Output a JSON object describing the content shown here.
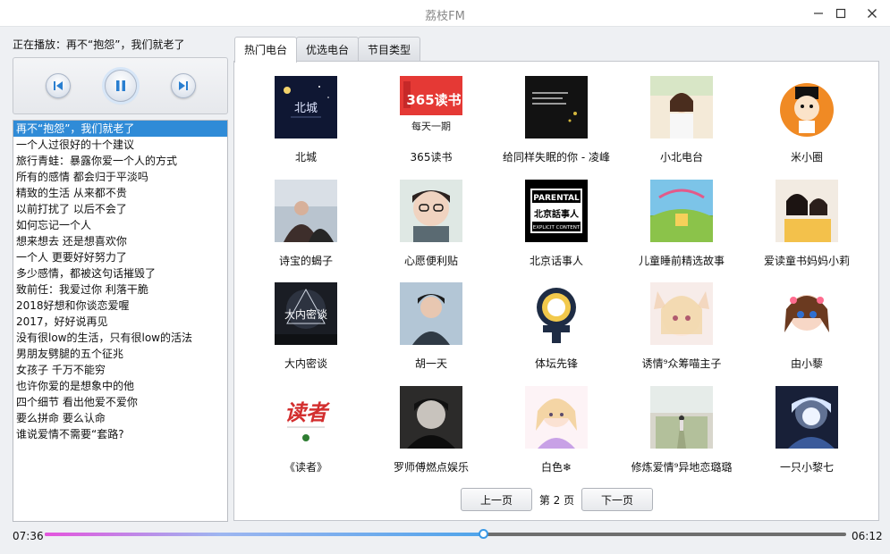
{
  "window": {
    "title": "荔枝FM"
  },
  "now_playing": {
    "prefix": "正在播放：",
    "title": "再不“抱怨”，我们就老了"
  },
  "playlist": {
    "selected_index": 0,
    "items": [
      "再不“抱怨”，我们就老了",
      "一个人过很好的十个建议",
      "旅行青蛙：暴露你爱一个人的方式",
      "所有的感情 都会归于平淡吗",
      "精致的生活 从来都不贵",
      "以前打扰了 以后不会了",
      "如何忘记一个人",
      "想来想去 还是想喜欢你",
      "一个人 更要好好努力了",
      "多少感情，都被这句话摧毁了",
      "致前任：我爱过你 利落干脆",
      "2018好想和你谈恋爱喔",
      "2017，好好说再见",
      "没有很low的生活，只有很low的活法",
      "男朋友劈腿的五个征兆",
      "女孩子 千万不能穷",
      "也许你爱的是想象中的他",
      "四个细节 看出他爱不爱你",
      "要么拼命 要么认命",
      "谁说爱情不需要“套路?"
    ]
  },
  "tabs": [
    "热门电台",
    "优选电台",
    "节目类型"
  ],
  "active_tab": 0,
  "stations": [
    {
      "name": "北城"
    },
    {
      "name": "365读书"
    },
    {
      "name": "给同样失眠的你 - 凌峰"
    },
    {
      "name": "小北电台"
    },
    {
      "name": "米小圈"
    },
    {
      "name": "诗宝的蝎子"
    },
    {
      "name": "心愿便利贴"
    },
    {
      "name": "北京话事人"
    },
    {
      "name": "儿童睡前精选故事"
    },
    {
      "name": "爱读童书妈妈小莉"
    },
    {
      "name": "大内密谈"
    },
    {
      "name": "胡一天"
    },
    {
      "name": "体坛先锋"
    },
    {
      "name": "诱情⁹众筹喵主子"
    },
    {
      "name": "由小藜"
    },
    {
      "name": "《读者》"
    },
    {
      "name": "罗师傅燃点娱乐"
    },
    {
      "name": "白色❄"
    },
    {
      "name": "修炼爱情⁹异地恋璐璐"
    },
    {
      "name": "一只小黎七"
    }
  ],
  "cover_texts": {
    "c2_top": "365读书",
    "c2_bottom": "每天一期",
    "c8_line1": "PARENTAL",
    "c8_line2": "北京話事人",
    "c8_line3": "EXPLICIT CONTENT",
    "c11_text": "大内密谈",
    "c16_text": "读者"
  },
  "pager": {
    "prev": "上一页",
    "page_label": "第 2 页",
    "next": "下一页"
  },
  "player": {
    "elapsed": "07:36",
    "total": "06:12",
    "progress_fraction": 0.547
  },
  "colors": {
    "accent": "#2f8bd7",
    "progress_start": "#e455dd",
    "progress_end": "#4fa4ea"
  }
}
